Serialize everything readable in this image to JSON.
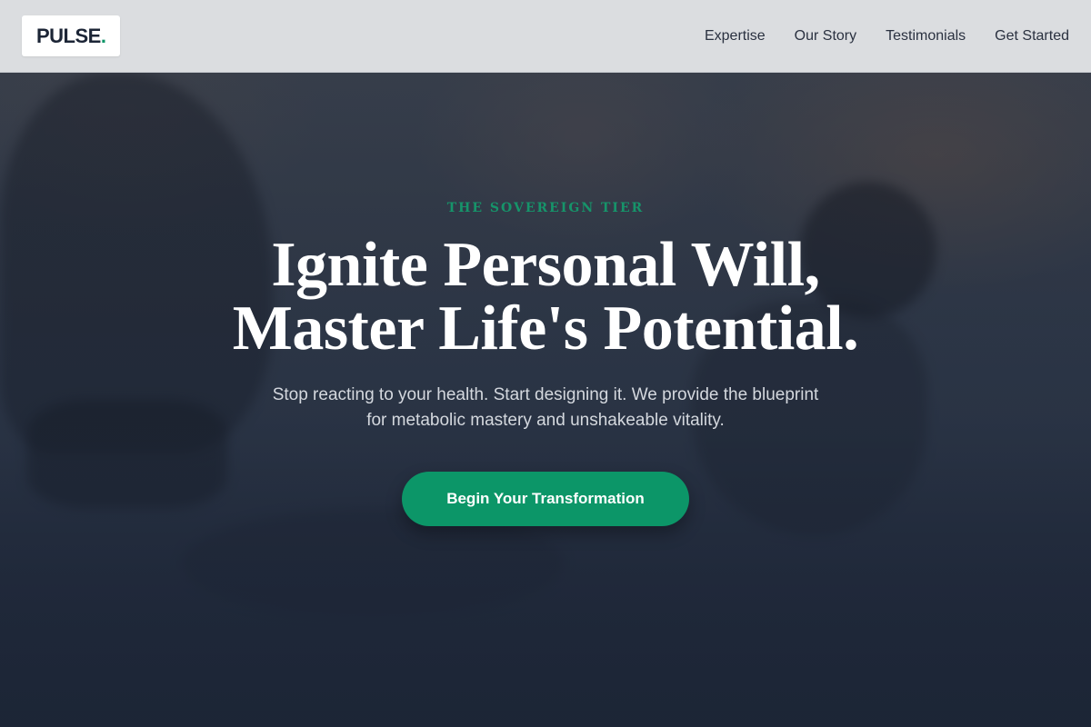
{
  "brand": {
    "name": "PULSE",
    "dot": ".",
    "accent_color": "#0d9668"
  },
  "nav": {
    "items": [
      {
        "label": "Expertise"
      },
      {
        "label": "Our Story"
      },
      {
        "label": "Testimonials"
      },
      {
        "label": "Get Started"
      }
    ]
  },
  "hero": {
    "eyebrow": "THE SOVEREIGN TIER",
    "headline_line1": "Ignite Personal Will,",
    "headline_line2": "Master Life's Potential.",
    "subtext": "Stop reacting to your health. Start designing it. We provide the blueprint for metabolic mastery and unshakeable vitality.",
    "cta_label": "Begin Your Transformation",
    "cta_color": "#0c9668",
    "background_color": "#1c2536"
  }
}
